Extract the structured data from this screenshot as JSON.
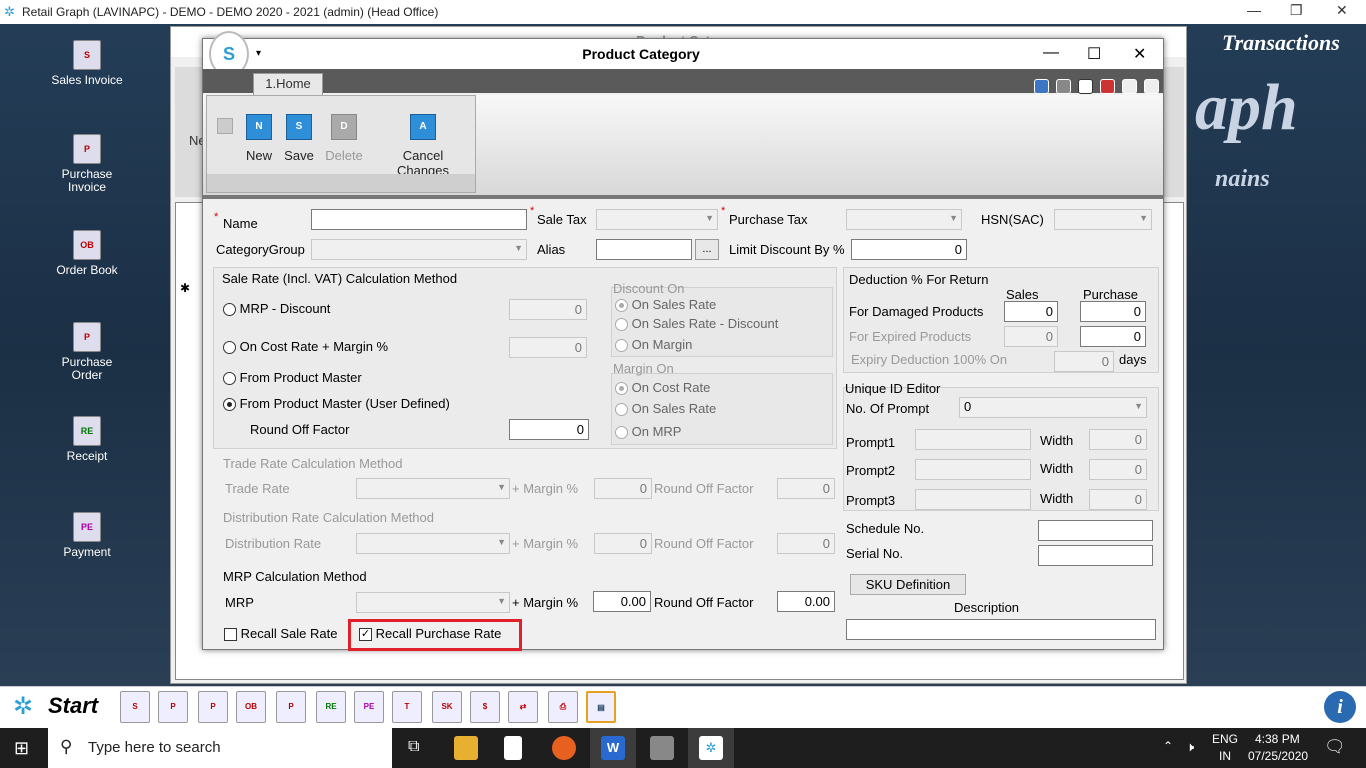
{
  "app_title": "Retail Graph (LAVINAPC) - DEMO - DEMO  2020 - 2021 (admin) (Head Office)",
  "brand": {
    "line1": "Transactions",
    "line2": "aph",
    "line3": "nains"
  },
  "desktop_icons": [
    {
      "label": "Sales Invoice",
      "icon": "sales-invoice-icon"
    },
    {
      "label": "Purchase Invoice",
      "icon": "purchase-invoice-icon"
    },
    {
      "label": "Order Book",
      "icon": "order-book-icon"
    },
    {
      "label": "Purchase Order",
      "icon": "purchase-order-icon"
    },
    {
      "label": "Receipt",
      "icon": "receipt-icon"
    },
    {
      "label": "Payment",
      "icon": "payment-icon"
    }
  ],
  "bg_window": {
    "title": "Product Cat...",
    "new_label": "Ne"
  },
  "dialog": {
    "title": "Product Category",
    "tab": "1.Home",
    "buttons": {
      "new": "New",
      "save": "Save",
      "delete": "Delete",
      "cancel": "Cancel Changes"
    },
    "name_label": "Name",
    "sale_tax_label": "Sale Tax",
    "purchase_tax_label": "Purchase Tax",
    "hsn_label": "HSN(SAC)",
    "category_group_label": "CategoryGroup",
    "alias_label": "Alias",
    "alias_btn": "...",
    "limit_discount_label": "Limit Discount By %",
    "limit_discount_value": "0",
    "sale_rate": {
      "title": "Sale Rate (Incl. VAT) Calculation Method",
      "mrp_discount": "MRP - Discount",
      "mrp_discount_value": "0",
      "on_cost": "On Cost Rate + Margin %",
      "on_cost_value": "0",
      "from_master": "From Product Master",
      "from_master_user": "From Product Master (User Defined)",
      "round_off": "Round Off Factor",
      "round_off_value": "0"
    },
    "discount_on": {
      "title": "Discount On",
      "o1": "On Sales Rate",
      "o2": "On Sales Rate - Discount",
      "o3": "On Margin"
    },
    "margin_on": {
      "title": "Margin On",
      "o1": "On Cost Rate",
      "o2": "On Sales Rate",
      "o3": "On MRP"
    },
    "trade": {
      "title": "Trade Rate Calculation Method",
      "label": "Trade Rate",
      "margin": "+ Margin %",
      "margin_value": "0",
      "round": "Round Off Factor",
      "round_value": "0"
    },
    "dist": {
      "title": "Distribution Rate Calculation Method",
      "label": "Distribution Rate",
      "margin": "+ Margin %",
      "margin_value": "0",
      "round": "Round Off Factor",
      "round_value": "0"
    },
    "mrp": {
      "title": "MRP Calculation Method",
      "label": "MRP",
      "margin": "+ Margin %",
      "margin_value": "0.00",
      "round": "Round Off Factor",
      "round_value": "0.00"
    },
    "recall_sale": "Recall Sale Rate",
    "recall_purchase": "Recall Purchase Rate",
    "deduction": {
      "title": "Deduction % For Return",
      "sales": "Sales",
      "purchase": "Purchase",
      "damaged": "For Damaged Products",
      "damaged_s": "0",
      "damaged_p": "0",
      "expired": "For Expired Products",
      "expired_s": "0",
      "expired_p": "0",
      "expiry": "Expiry Deduction 100% On",
      "expiry_v": "0",
      "days": "days"
    },
    "unique": {
      "title": "Unique ID Editor",
      "prompts_label": "No. Of Prompt",
      "prompts_value": "0",
      "p1": "Prompt1",
      "p2": "Prompt2",
      "p3": "Prompt3",
      "width": "Width",
      "w1": "0",
      "w2": "0",
      "w3": "0"
    },
    "schedule": "Schedule No.",
    "serial": "Serial No.",
    "sku": "SKU Definition",
    "description": "Description"
  },
  "taskbar_app": {
    "start": "Start"
  },
  "windows_taskbar": {
    "search": "Type here to search",
    "lang1": "ENG",
    "lang2": "IN",
    "time": "4:38 PM",
    "date": "07/25/2020"
  }
}
